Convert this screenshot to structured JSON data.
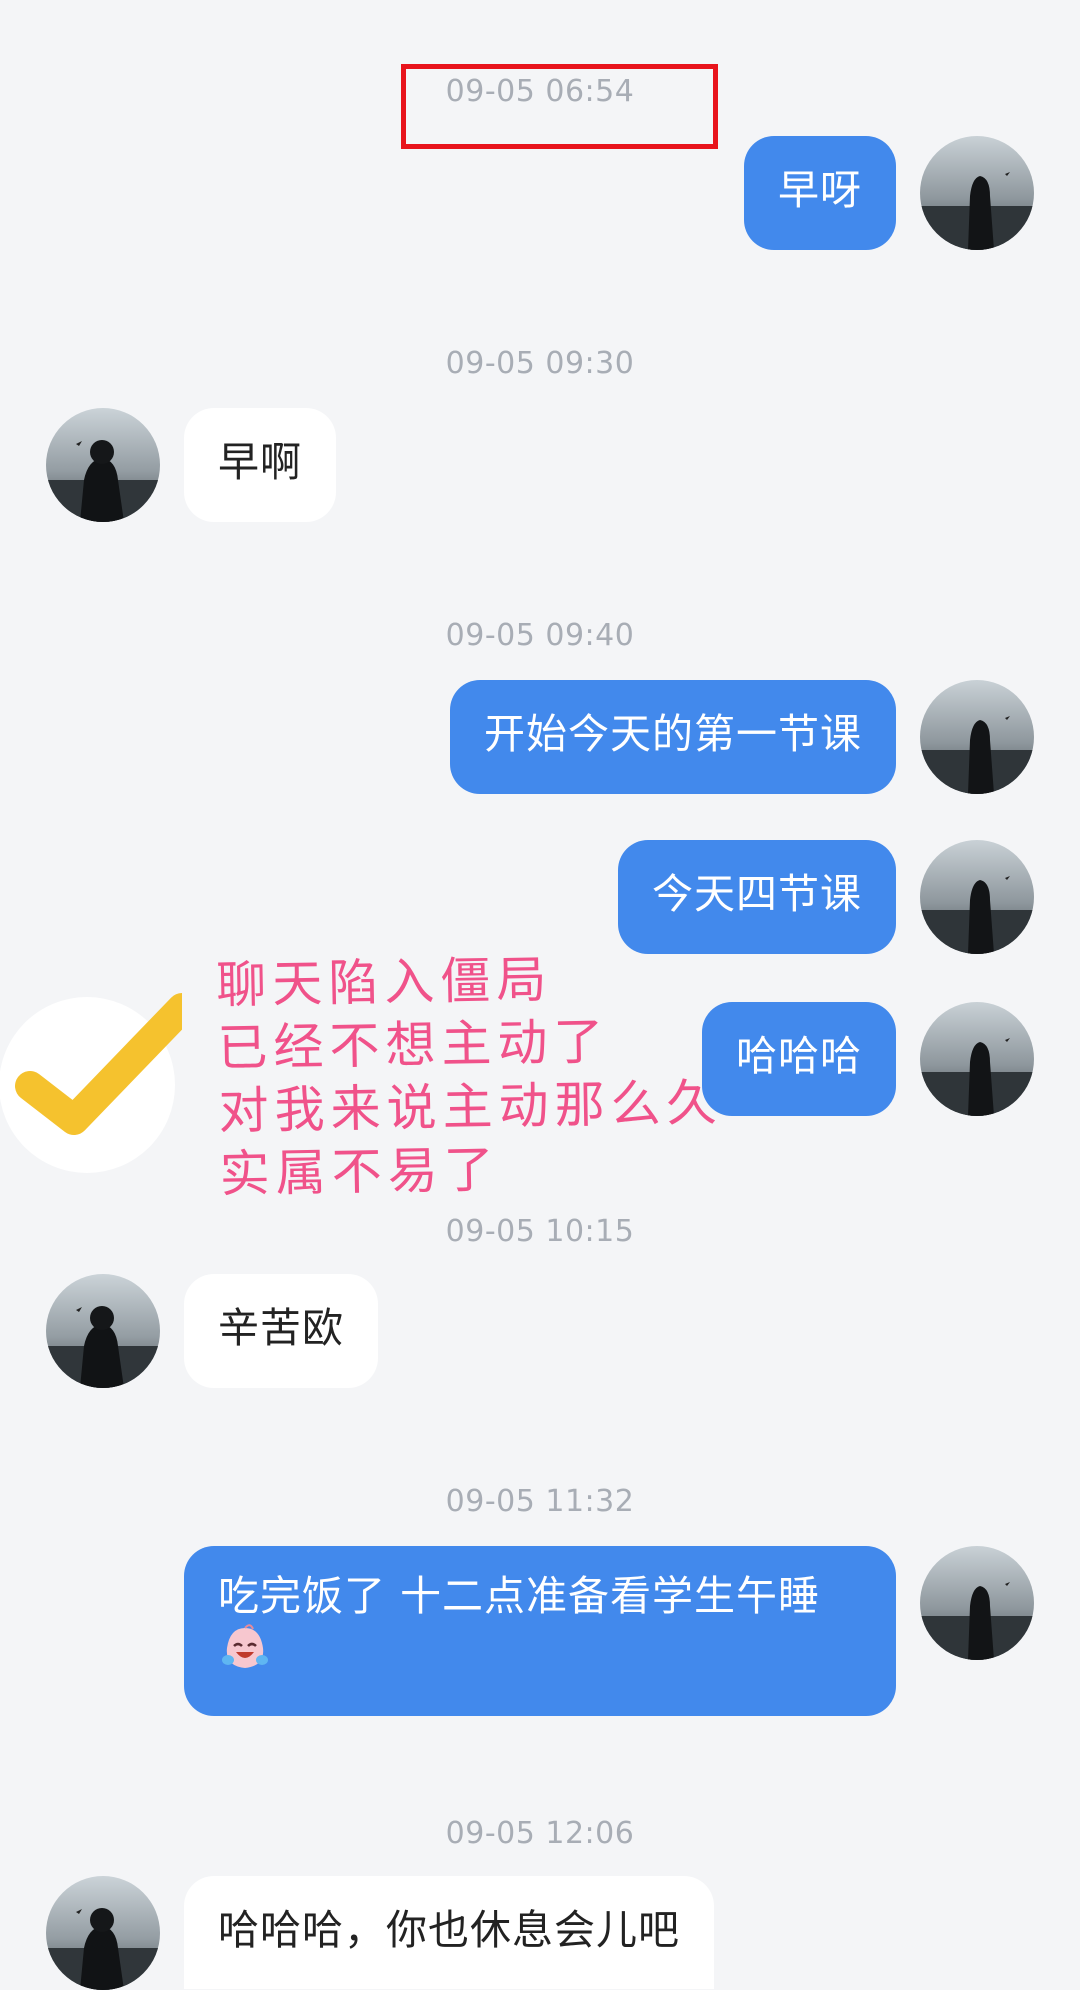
{
  "chat": {
    "messages": [
      {
        "time": "09-05 06:54",
        "from": "self",
        "text": "早呀"
      },
      {
        "time": "09-05 09:30",
        "from": "other",
        "text": "早啊"
      },
      {
        "time": "09-05 09:40",
        "from": "self",
        "text": "开始今天的第一节课"
      },
      {
        "from": "self",
        "text": "今天四节课"
      },
      {
        "from": "self",
        "text": "哈哈哈"
      },
      {
        "time": "09-05 10:15",
        "from": "other",
        "text": "辛苦欧"
      },
      {
        "time": "09-05 11:32",
        "from": "self",
        "text": "吃完饭了 十二点准备看学生午睡",
        "emoji": "crying-laughing-emoji"
      },
      {
        "time": "09-05 12:06",
        "from": "other",
        "text": "哈哈哈，你也休息会儿吧"
      }
    ]
  },
  "annotation": {
    "lines": [
      "聊天陷入僵局",
      "已经不想主动了",
      "对我来说主动那么久",
      "实属不易了"
    ],
    "color": "#f0528a"
  },
  "colors": {
    "self_bubble": "#4289ec",
    "other_bubble": "#ffffff",
    "background": "#f4f5f7",
    "highlight_box": "#e8141c",
    "check_mark": "#f5c22e"
  },
  "icons": {
    "self_avatar": "avatar-girl-at-sea",
    "other_avatar": "avatar-boy-at-sea",
    "check": "check-mark-icon"
  }
}
